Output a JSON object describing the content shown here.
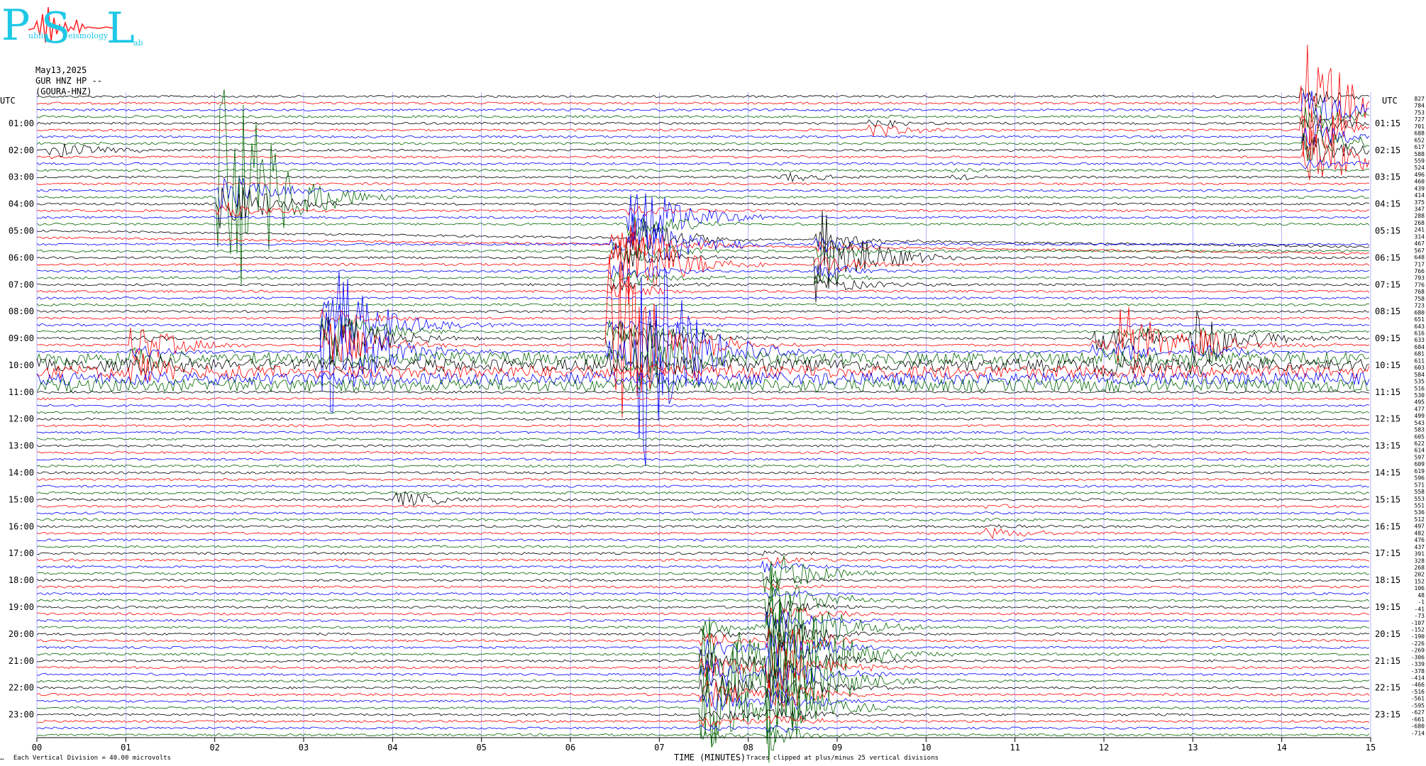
{
  "logo": {
    "big_letters": [
      "P",
      "S",
      "L"
    ],
    "small_words": [
      "ublic",
      "eismology",
      "ab"
    ]
  },
  "header": {
    "date": "May13,2025",
    "channel": "GUR HNZ HP --",
    "station": "(GOURA-HNZ)"
  },
  "utc_left": "UTC",
  "utc_right": "UTC",
  "xlabel": "TIME (MINUTES)",
  "footer": {
    "scale": "Each Vertical Division =   40.00 microvolts",
    "clip": "Traces clipped at plus/minus 25 vertical divisions",
    "left_mark": "…"
  },
  "colors": {
    "trace_cycle": [
      "#000000",
      "#ff0000",
      "#0000ff",
      "#006400"
    ],
    "grid": "#8080ff",
    "logo": "#1ec8e6"
  },
  "chart_data": {
    "type": "line",
    "title": "",
    "xlim": [
      0,
      15
    ],
    "x_ticks": [
      "00",
      "01",
      "02",
      "03",
      "04",
      "05",
      "06",
      "07",
      "08",
      "09",
      "10",
      "11",
      "12",
      "13",
      "14",
      "15"
    ],
    "left_hour_labels": [
      "01:00",
      "02:00",
      "03:00",
      "04:00",
      "05:00",
      "06:00",
      "07:00",
      "08:00",
      "09:00",
      "10:00",
      "11:00",
      "12:00",
      "13:00",
      "14:00",
      "15:00",
      "16:00",
      "17:00",
      "18:00",
      "19:00",
      "20:00",
      "21:00",
      "22:00",
      "23:00"
    ],
    "right_hour_labels": [
      "01:15",
      "02:15",
      "03:15",
      "04:15",
      "05:15",
      "06:15",
      "07:15",
      "08:15",
      "09:15",
      "10:15",
      "11:15",
      "12:15",
      "13:15",
      "14:15",
      "15:15",
      "16:15",
      "17:15",
      "18:15",
      "19:15",
      "20:15",
      "21:15",
      "22:15",
      "23:15"
    ],
    "trace_count": 96,
    "right_dc_offsets": [
      "827",
      "784",
      "753",
      "727",
      "701",
      "688",
      "652",
      "617",
      "588",
      "559",
      "524",
      "496",
      "460",
      "439",
      "414",
      "375",
      "347",
      "288",
      "268",
      "241",
      "314",
      "467",
      "567",
      "648",
      "717",
      "766",
      "793",
      "776",
      "768",
      "758",
      "723",
      "680",
      "651",
      "643",
      "616",
      "633",
      "684",
      "681",
      "611",
      "603",
      "584",
      "535",
      "516",
      "530",
      "495",
      "477",
      "499",
      "543",
      "583",
      "605",
      "622",
      "614",
      "597",
      "609",
      "619",
      "596",
      "571",
      "558",
      "553",
      "551",
      "536",
      "512",
      "497",
      "482",
      "476",
      "437",
      "391",
      "328",
      "268",
      "202",
      "152",
      "106",
      "48",
      "-1",
      "-41",
      "-73",
      "-107",
      "-152",
      "-190",
      "-226",
      "-269",
      "-306",
      "-339",
      "-378",
      "-414",
      "-466",
      "-516",
      "-561",
      "-595",
      "-627",
      "-661",
      "-680",
      "-714"
    ],
    "events": [
      {
        "minute": 2.18,
        "hour": 3.8,
        "amplitude": 220,
        "color_index": 3,
        "decay": 0.55
      },
      {
        "minute": 14.35,
        "hour": 0.5,
        "amplitude": 120,
        "color_index": 1,
        "decay": 0.9
      },
      {
        "minute": 14.38,
        "hour": 1.8,
        "amplitude": 110,
        "color_index": 1,
        "decay": 0.9
      },
      {
        "minute": 9.5,
        "hour": 1.0,
        "amplitude": 18,
        "color_index": 1,
        "decay": 0.5
      },
      {
        "minute": 0.25,
        "hour": 2.0,
        "amplitude": 12,
        "color_index": 0,
        "decay": 0.4
      },
      {
        "minute": 8.5,
        "hour": 2.8,
        "amplitude": 12,
        "color_index": 0,
        "decay": 0.4
      },
      {
        "minute": 10.4,
        "hour": 2.75,
        "amplitude": 12,
        "color_index": 0,
        "decay": 0.4
      },
      {
        "minute": 8.9,
        "hour": 6.0,
        "amplitude": 70,
        "color_index": 0,
        "decay": 1.2
      },
      {
        "minute": 6.6,
        "hour": 6.2,
        "amplitude": 90,
        "color_index": 1,
        "decay": 1.2
      },
      {
        "minute": 6.8,
        "hour": 5.0,
        "amplitude": 110,
        "color_index": 2,
        "decay": 1.0
      },
      {
        "minute": 3.35,
        "hour": 9.0,
        "amplitude": 190,
        "color_index": 2,
        "decay": 1.0
      },
      {
        "minute": 6.9,
        "hour": 9.5,
        "amplitude": 180,
        "color_index": 2,
        "decay": 1.0
      },
      {
        "minute": 6.55,
        "hour": 9.3,
        "amplitude": 140,
        "color_index": 1,
        "decay": 1.0
      },
      {
        "minute": 12.3,
        "hour": 9.2,
        "amplitude": 60,
        "color_index": 1,
        "decay": 0.8
      },
      {
        "minute": 13.1,
        "hour": 9.3,
        "amplitude": 70,
        "color_index": 0,
        "decay": 0.8
      },
      {
        "minute": 12.0,
        "hour": 9.4,
        "amplitude": 40,
        "color_index": 0,
        "decay": 0.8
      },
      {
        "minute": 1.2,
        "hour": 9.7,
        "amplitude": 50,
        "color_index": 1,
        "decay": 1.0
      },
      {
        "minute": 8.35,
        "hour": 21.0,
        "amplitude": 140,
        "color_index": 3,
        "decay": 3.0
      },
      {
        "minute": 7.6,
        "hour": 21.7,
        "amplitude": 110,
        "color_index": 3,
        "decay": 2.2
      },
      {
        "minute": 4.15,
        "hour": 14.9,
        "amplitude": 15,
        "color_index": 0,
        "decay": 0.4
      },
      {
        "minute": 10.8,
        "hour": 16.0,
        "amplitude": 10,
        "color_index": 1,
        "decay": 1.0
      },
      {
        "minute": 8.3,
        "hour": 17.6,
        "amplitude": 40,
        "color_index": 3,
        "decay": 0.8
      }
    ],
    "busy_band": {
      "hour_start": 9.6,
      "hour_end": 10.8,
      "noise": 9
    }
  }
}
